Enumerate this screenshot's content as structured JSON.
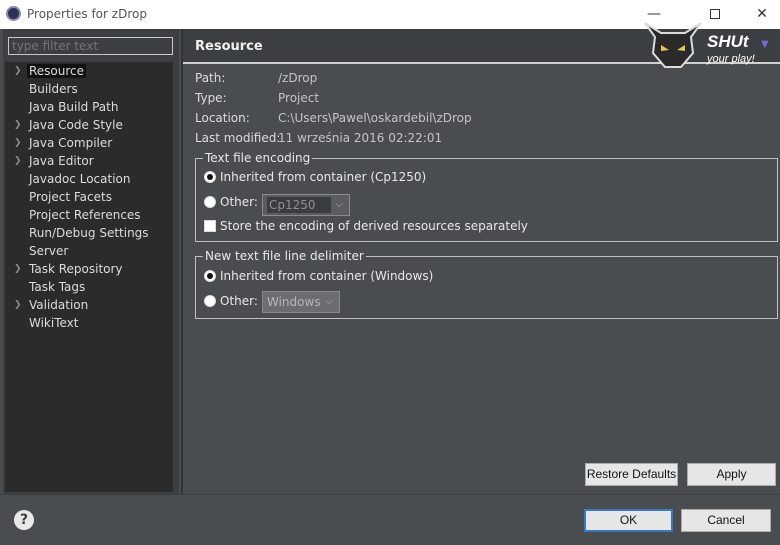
{
  "window": {
    "title": "Properties for zDrop",
    "icon": "eclipse-icon"
  },
  "filter": {
    "placeholder": "type filter text"
  },
  "tree": {
    "items": [
      {
        "label": "Resource",
        "expandable": true,
        "selected": true
      },
      {
        "label": "Builders",
        "expandable": false
      },
      {
        "label": "Java Build Path",
        "expandable": false
      },
      {
        "label": "Java Code Style",
        "expandable": true
      },
      {
        "label": "Java Compiler",
        "expandable": true
      },
      {
        "label": "Java Editor",
        "expandable": true
      },
      {
        "label": "Javadoc Location",
        "expandable": false
      },
      {
        "label": "Project Facets",
        "expandable": false
      },
      {
        "label": "Project References",
        "expandable": false
      },
      {
        "label": "Run/Debug Settings",
        "expandable": false
      },
      {
        "label": "Server",
        "expandable": false
      },
      {
        "label": "Task Repository",
        "expandable": true
      },
      {
        "label": "Task Tags",
        "expandable": false
      },
      {
        "label": "Validation",
        "expandable": true
      },
      {
        "label": "WikiText",
        "expandable": false
      }
    ]
  },
  "page": {
    "title": "Resource",
    "properties": [
      {
        "key": "Path:",
        "value": "/zDrop"
      },
      {
        "key": "Type:",
        "value": "Project"
      },
      {
        "key": "Location:",
        "value": "C:\\Users\\Pawel\\oskardebil\\zDrop"
      },
      {
        "key": "Last modified:",
        "value": "11 września 2016 02:22:01"
      }
    ],
    "encoding": {
      "legend": "Text file encoding",
      "inherited_label": "Inherited from container (Cp1250)",
      "other_label": "Other:",
      "other_value": "Cp1250",
      "store_label": "Store the encoding of derived resources separately"
    },
    "delimiter": {
      "legend": "New text file line delimiter",
      "inherited_label": "Inherited from container (Windows)",
      "other_label": "Other:",
      "other_value": "Windows"
    },
    "restore_label": "Restore Defaults",
    "apply_label": "Apply"
  },
  "watermark": {
    "line1": "SHUt",
    "line2": "your play!"
  },
  "footer": {
    "ok_label": "OK",
    "cancel_label": "Cancel",
    "help_icon": "help-icon"
  },
  "colors": {
    "accent": "#3b78c4",
    "panel": "#3c3f41",
    "background": "#4a4d50"
  }
}
